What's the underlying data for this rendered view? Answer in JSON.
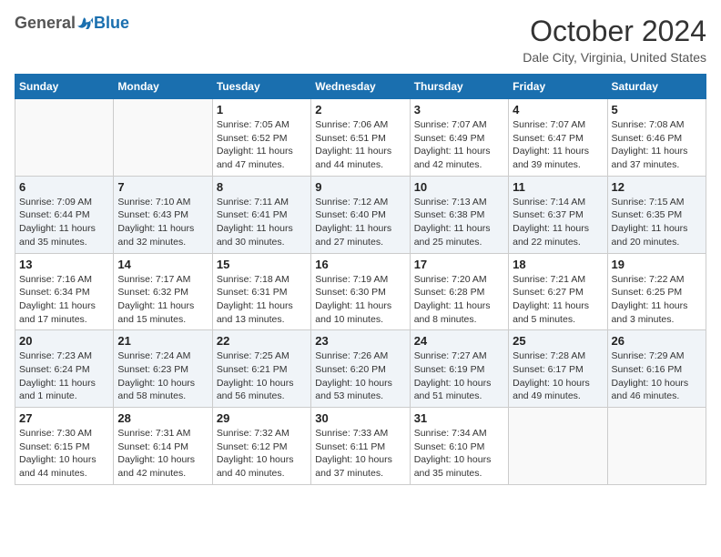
{
  "header": {
    "logo_general": "General",
    "logo_blue": "Blue",
    "month_title": "October 2024",
    "location": "Dale City, Virginia, United States"
  },
  "weekdays": [
    "Sunday",
    "Monday",
    "Tuesday",
    "Wednesday",
    "Thursday",
    "Friday",
    "Saturday"
  ],
  "weeks": [
    [
      {
        "day": "",
        "sunrise": "",
        "sunset": "",
        "daylight": ""
      },
      {
        "day": "",
        "sunrise": "",
        "sunset": "",
        "daylight": ""
      },
      {
        "day": "1",
        "sunrise": "Sunrise: 7:05 AM",
        "sunset": "Sunset: 6:52 PM",
        "daylight": "Daylight: 11 hours and 47 minutes."
      },
      {
        "day": "2",
        "sunrise": "Sunrise: 7:06 AM",
        "sunset": "Sunset: 6:51 PM",
        "daylight": "Daylight: 11 hours and 44 minutes."
      },
      {
        "day": "3",
        "sunrise": "Sunrise: 7:07 AM",
        "sunset": "Sunset: 6:49 PM",
        "daylight": "Daylight: 11 hours and 42 minutes."
      },
      {
        "day": "4",
        "sunrise": "Sunrise: 7:07 AM",
        "sunset": "Sunset: 6:47 PM",
        "daylight": "Daylight: 11 hours and 39 minutes."
      },
      {
        "day": "5",
        "sunrise": "Sunrise: 7:08 AM",
        "sunset": "Sunset: 6:46 PM",
        "daylight": "Daylight: 11 hours and 37 minutes."
      }
    ],
    [
      {
        "day": "6",
        "sunrise": "Sunrise: 7:09 AM",
        "sunset": "Sunset: 6:44 PM",
        "daylight": "Daylight: 11 hours and 35 minutes."
      },
      {
        "day": "7",
        "sunrise": "Sunrise: 7:10 AM",
        "sunset": "Sunset: 6:43 PM",
        "daylight": "Daylight: 11 hours and 32 minutes."
      },
      {
        "day": "8",
        "sunrise": "Sunrise: 7:11 AM",
        "sunset": "Sunset: 6:41 PM",
        "daylight": "Daylight: 11 hours and 30 minutes."
      },
      {
        "day": "9",
        "sunrise": "Sunrise: 7:12 AM",
        "sunset": "Sunset: 6:40 PM",
        "daylight": "Daylight: 11 hours and 27 minutes."
      },
      {
        "day": "10",
        "sunrise": "Sunrise: 7:13 AM",
        "sunset": "Sunset: 6:38 PM",
        "daylight": "Daylight: 11 hours and 25 minutes."
      },
      {
        "day": "11",
        "sunrise": "Sunrise: 7:14 AM",
        "sunset": "Sunset: 6:37 PM",
        "daylight": "Daylight: 11 hours and 22 minutes."
      },
      {
        "day": "12",
        "sunrise": "Sunrise: 7:15 AM",
        "sunset": "Sunset: 6:35 PM",
        "daylight": "Daylight: 11 hours and 20 minutes."
      }
    ],
    [
      {
        "day": "13",
        "sunrise": "Sunrise: 7:16 AM",
        "sunset": "Sunset: 6:34 PM",
        "daylight": "Daylight: 11 hours and 17 minutes."
      },
      {
        "day": "14",
        "sunrise": "Sunrise: 7:17 AM",
        "sunset": "Sunset: 6:32 PM",
        "daylight": "Daylight: 11 hours and 15 minutes."
      },
      {
        "day": "15",
        "sunrise": "Sunrise: 7:18 AM",
        "sunset": "Sunset: 6:31 PM",
        "daylight": "Daylight: 11 hours and 13 minutes."
      },
      {
        "day": "16",
        "sunrise": "Sunrise: 7:19 AM",
        "sunset": "Sunset: 6:30 PM",
        "daylight": "Daylight: 11 hours and 10 minutes."
      },
      {
        "day": "17",
        "sunrise": "Sunrise: 7:20 AM",
        "sunset": "Sunset: 6:28 PM",
        "daylight": "Daylight: 11 hours and 8 minutes."
      },
      {
        "day": "18",
        "sunrise": "Sunrise: 7:21 AM",
        "sunset": "Sunset: 6:27 PM",
        "daylight": "Daylight: 11 hours and 5 minutes."
      },
      {
        "day": "19",
        "sunrise": "Sunrise: 7:22 AM",
        "sunset": "Sunset: 6:25 PM",
        "daylight": "Daylight: 11 hours and 3 minutes."
      }
    ],
    [
      {
        "day": "20",
        "sunrise": "Sunrise: 7:23 AM",
        "sunset": "Sunset: 6:24 PM",
        "daylight": "Daylight: 11 hours and 1 minute."
      },
      {
        "day": "21",
        "sunrise": "Sunrise: 7:24 AM",
        "sunset": "Sunset: 6:23 PM",
        "daylight": "Daylight: 10 hours and 58 minutes."
      },
      {
        "day": "22",
        "sunrise": "Sunrise: 7:25 AM",
        "sunset": "Sunset: 6:21 PM",
        "daylight": "Daylight: 10 hours and 56 minutes."
      },
      {
        "day": "23",
        "sunrise": "Sunrise: 7:26 AM",
        "sunset": "Sunset: 6:20 PM",
        "daylight": "Daylight: 10 hours and 53 minutes."
      },
      {
        "day": "24",
        "sunrise": "Sunrise: 7:27 AM",
        "sunset": "Sunset: 6:19 PM",
        "daylight": "Daylight: 10 hours and 51 minutes."
      },
      {
        "day": "25",
        "sunrise": "Sunrise: 7:28 AM",
        "sunset": "Sunset: 6:17 PM",
        "daylight": "Daylight: 10 hours and 49 minutes."
      },
      {
        "day": "26",
        "sunrise": "Sunrise: 7:29 AM",
        "sunset": "Sunset: 6:16 PM",
        "daylight": "Daylight: 10 hours and 46 minutes."
      }
    ],
    [
      {
        "day": "27",
        "sunrise": "Sunrise: 7:30 AM",
        "sunset": "Sunset: 6:15 PM",
        "daylight": "Daylight: 10 hours and 44 minutes."
      },
      {
        "day": "28",
        "sunrise": "Sunrise: 7:31 AM",
        "sunset": "Sunset: 6:14 PM",
        "daylight": "Daylight: 10 hours and 42 minutes."
      },
      {
        "day": "29",
        "sunrise": "Sunrise: 7:32 AM",
        "sunset": "Sunset: 6:12 PM",
        "daylight": "Daylight: 10 hours and 40 minutes."
      },
      {
        "day": "30",
        "sunrise": "Sunrise: 7:33 AM",
        "sunset": "Sunset: 6:11 PM",
        "daylight": "Daylight: 10 hours and 37 minutes."
      },
      {
        "day": "31",
        "sunrise": "Sunrise: 7:34 AM",
        "sunset": "Sunset: 6:10 PM",
        "daylight": "Daylight: 10 hours and 35 minutes."
      },
      {
        "day": "",
        "sunrise": "",
        "sunset": "",
        "daylight": ""
      },
      {
        "day": "",
        "sunrise": "",
        "sunset": "",
        "daylight": ""
      }
    ]
  ]
}
